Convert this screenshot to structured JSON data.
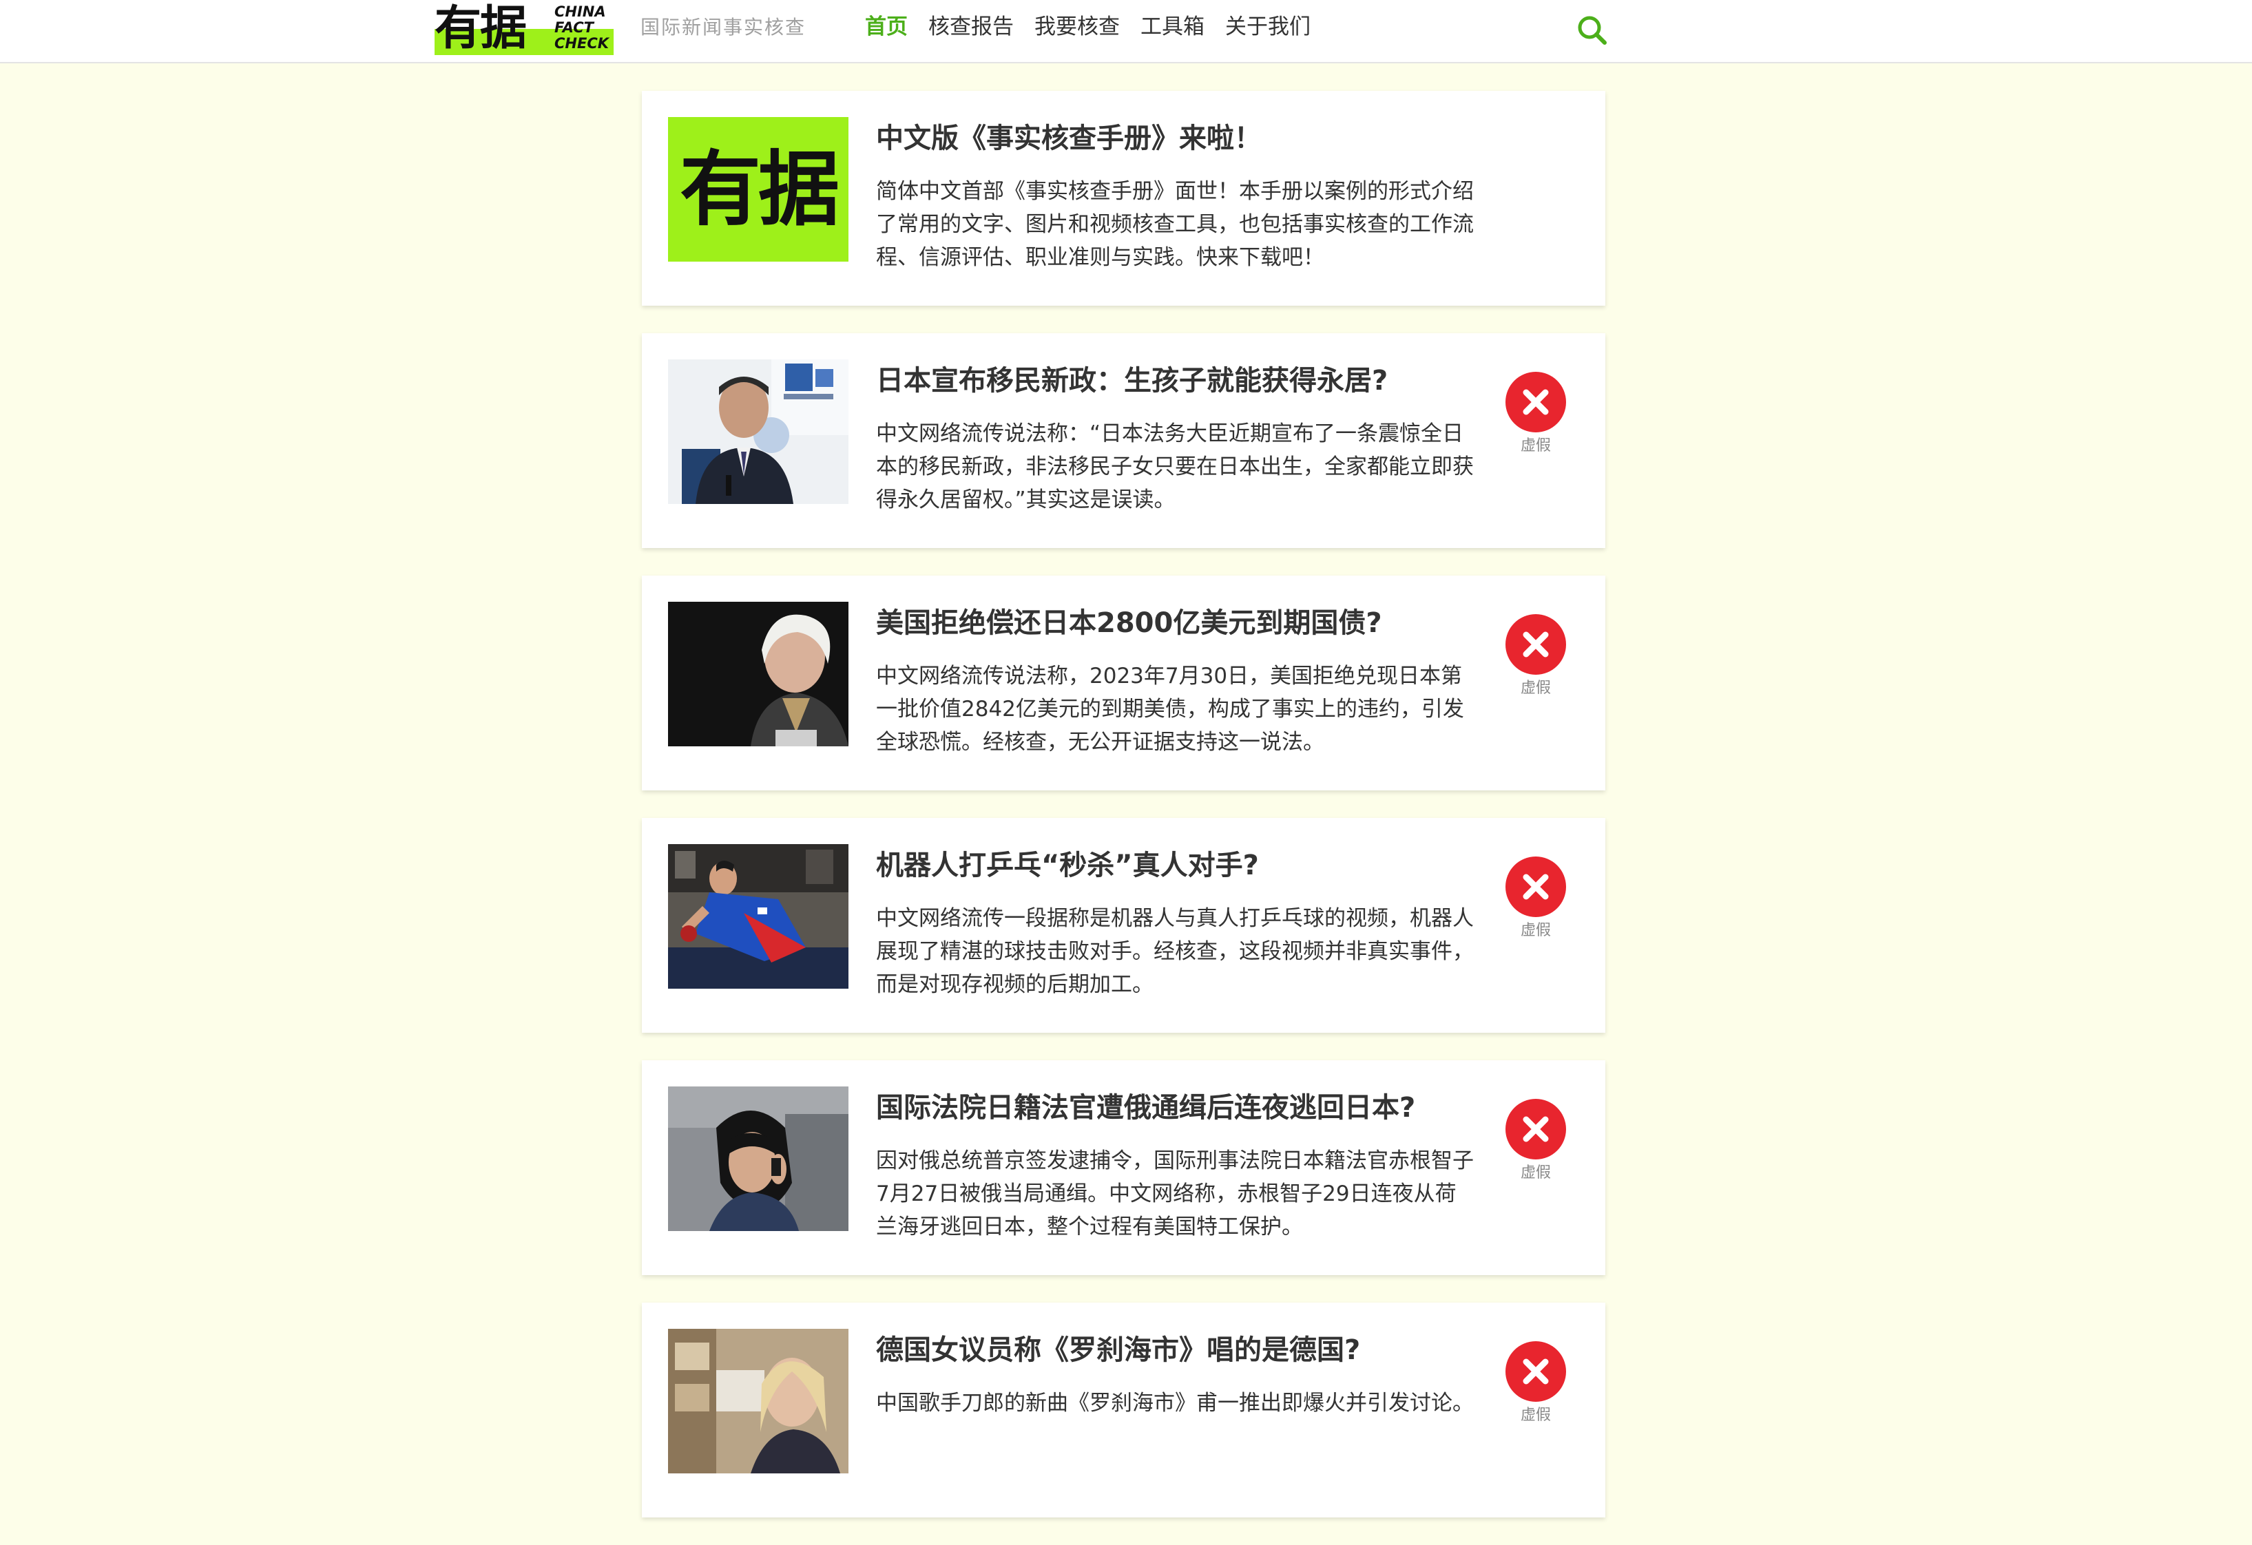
{
  "header": {
    "logo_cn": "有据",
    "logo_en_lines": [
      "CHINA",
      "FACT",
      "CHECK"
    ],
    "tagline": "国际新闻事实核查",
    "nav": [
      {
        "label": "首页"
      },
      {
        "label": "核查报告"
      },
      {
        "label": "我要核查"
      },
      {
        "label": "工具箱"
      },
      {
        "label": "关于我们"
      }
    ],
    "active_nav": "首页",
    "search_icon": "search-icon"
  },
  "colors": {
    "brand_green": "#9ef01a",
    "nav_active": "#4caf1a",
    "verdict_red": "#e8252e",
    "page_bg": "#fdfee9"
  },
  "feed": [
    {
      "title": "中文版《事实核查手册》来啦！",
      "summary": "简体中文首部《事实核查手册》面世！本手册以案例的形式介绍了常用的文字、图片和视频核查工具，也包括事实核查的工作流程、信源评估、职业准则与实践。快来下载吧！",
      "thumb_text": "有据"
    },
    {
      "title": "日本宣布移民新政：生孩子就能获得永居?",
      "summary": "中文网络流传说法称：“日本法务大臣近期宣布了一条震惊全日本的移民新政，非法移民子女只要在日本出生，全家都能立即获得永久居留权。”其实这是误读。",
      "verdict": "虚假"
    },
    {
      "title": "美国拒绝偿还日本2800亿美元到期国债?",
      "summary": "中文网络流传说法称，2023年7月30日，美国拒绝兑现日本第一批价值2842亿美元的到期美债，构成了事实上的违约，引发全球恐慌。经核查，无公开证据支持这一说法。",
      "verdict": "虚假"
    },
    {
      "title": "机器人打乒乓“秒杀”真人对手?",
      "summary": "中文网络流传一段据称是机器人与真人打乒乓球的视频，机器人展现了精湛的球技击败对手。经核查，这段视频并非真实事件，而是对现存视频的后期加工。",
      "verdict": "虚假"
    },
    {
      "title": "国际法院日籍法官遭俄通缉后连夜逃回日本?",
      "summary": "因对俄总统普京签发逮捕令，国际刑事法院日本籍法官赤根智子7月27日被俄当局通缉。中文网络称，赤根智子29日连夜从荷兰海牙逃回日本，整个过程有美国特工保护。",
      "verdict": "虚假"
    },
    {
      "title": "德国女议员称《罗刹海市》唱的是德国?",
      "summary": "中国歌手刀郎的新曲《罗刹海市》甫一推出即爆火并引发讨论。",
      "verdict": "虚假"
    }
  ]
}
